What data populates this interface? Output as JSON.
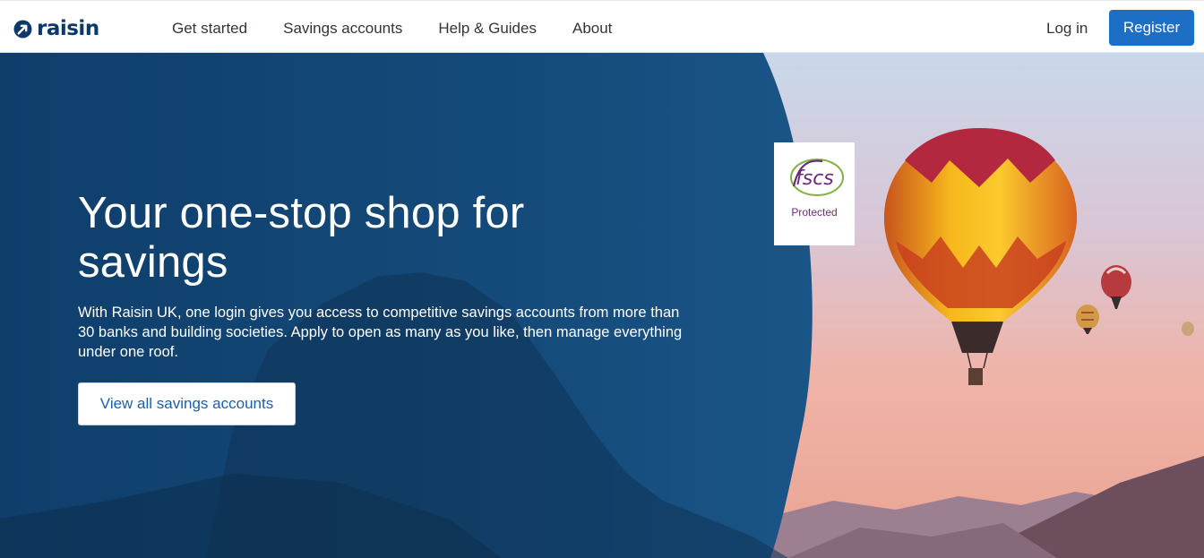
{
  "header": {
    "logo_text": "raisin",
    "nav": [
      "Get started",
      "Savings accounts",
      "Help & Guides",
      "About"
    ],
    "login_label": "Log in",
    "register_label": "Register"
  },
  "hero": {
    "headline": "Your one-stop shop for savings",
    "subtext": "With Raisin UK, one login gives you access to competitive savings accounts from more than 30 banks and building societies. Apply to open as many as you like, then manage everything under one roof.",
    "cta_label": "View all savings accounts",
    "badge": {
      "logo_text": "fscs",
      "label": "Protected"
    }
  },
  "colors": {
    "brand_navy": "#0b3a68",
    "primary_button": "#1d6ec5",
    "hero_panel": "#134a78",
    "badge_purple": "#6b2a7a"
  },
  "icons": [
    "raisin-logo-icon",
    "fscs-logo-icon",
    "hot-air-balloon-illustration",
    "mountain-illustration"
  ]
}
